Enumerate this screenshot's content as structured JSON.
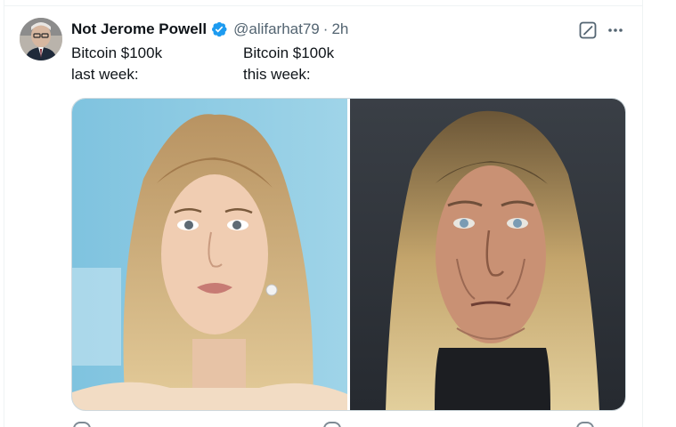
{
  "tweet": {
    "display_name": "Not Jerome Powell",
    "handle": "@alifarhat79",
    "separator": "·",
    "timestamp": "2h",
    "left_line1": "Bitcoin $100k",
    "left_line2": "last week:",
    "right_line1": "Bitcoin $100k",
    "right_line2": "this week:"
  },
  "icons": {
    "verified": "verified-badge-icon",
    "grok": "grok-icon",
    "more": "more-dots-icon"
  },
  "colors": {
    "verified_blue": "#1d9bf0",
    "secondary_text": "#536471",
    "primary_text": "#0f1419"
  }
}
